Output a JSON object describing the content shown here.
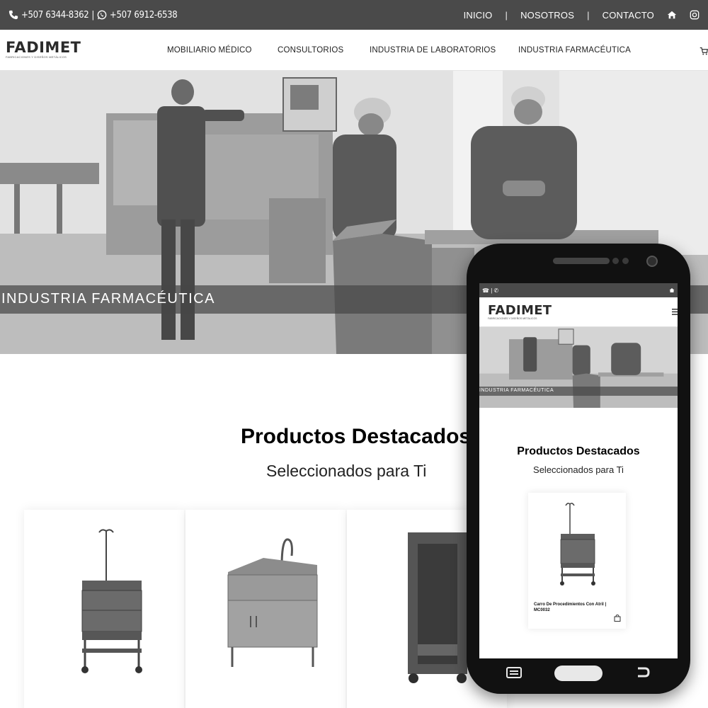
{
  "topbar": {
    "phone_1": "+507 6344-8362",
    "separator": "|",
    "phone_2": "+507 6912-6538",
    "nav": [
      "INICIO",
      "NOSOTROS",
      "CONTACTO"
    ]
  },
  "header": {
    "logo_text": "FADIMET",
    "logo_tagline": "FABRICACIONES Y DISEÑOS METÁLICOS",
    "menu": [
      "MOBILIARIO MÉDICO",
      "CONSULTORIOS",
      "INDUSTRIA DE LABORATORIOS",
      "INDUSTRIA FARMACÉUTICA"
    ]
  },
  "hero": {
    "title": "INDUSTRIA FARMACÉUTICA"
  },
  "featured": {
    "title": "Productos Destacados",
    "subtitle": "Seleccionados para Ti"
  },
  "products": [
    {
      "image_icon": "iv-stand-cart-icon"
    },
    {
      "image_icon": "sink-cabinet-icon"
    },
    {
      "image_icon": "rack-cart-icon"
    }
  ],
  "phone": {
    "topbar": "☎ | ✆",
    "logo_text": "FADIMET",
    "logo_tagline": "FABRICACIONES Y DISEÑOS METÁLICOS",
    "hero_title": "INDUSTRIA FARMACÉUTICA",
    "featured_title": "Productos Destacados",
    "featured_subtitle": "Seleccionados para Ti",
    "product_title": "Carro De Procedimientos Con Atril | MC0032"
  },
  "colors": {
    "topbar_bg": "#4a4a4a",
    "page_bg": "#ffffff",
    "phone_body": "#111111"
  }
}
